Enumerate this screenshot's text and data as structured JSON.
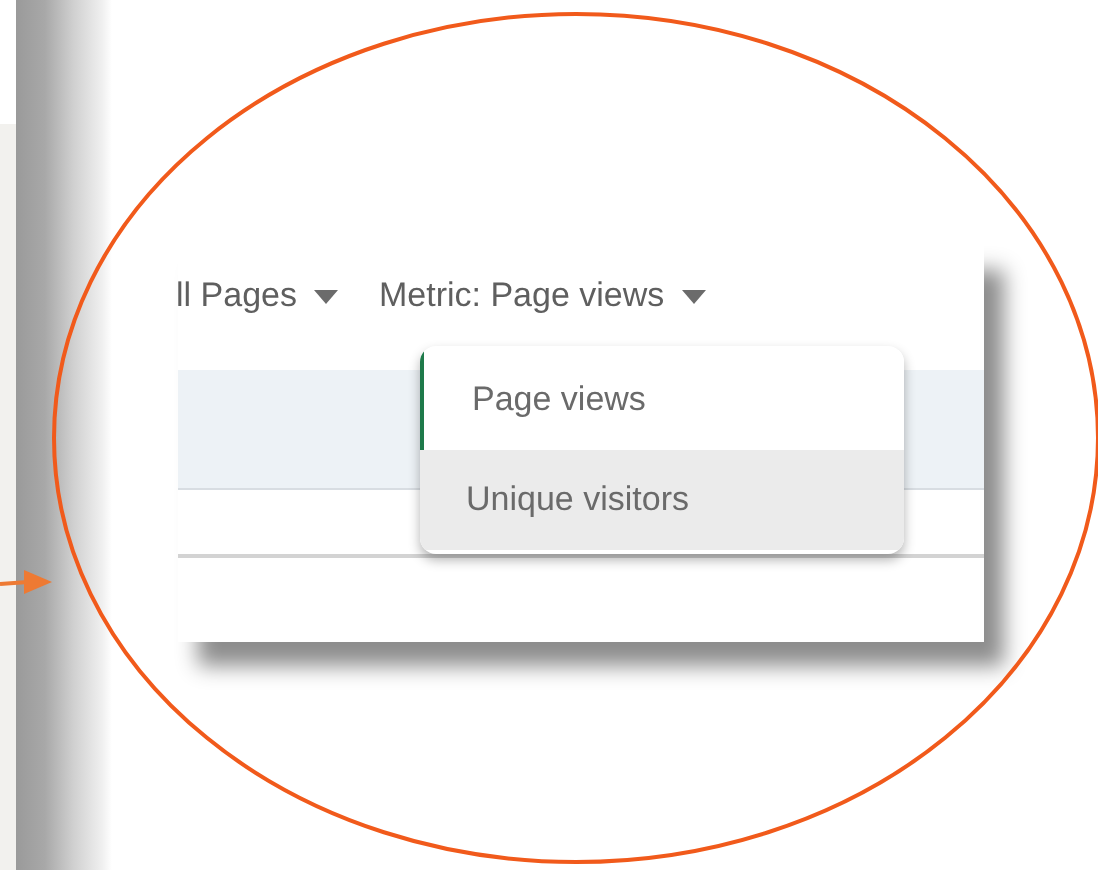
{
  "filters": [
    {
      "label": "ll Pages"
    },
    {
      "label": "Metric: Page views"
    }
  ],
  "metric_menu": {
    "items": [
      {
        "label": "Page views",
        "selected": true,
        "highlighted": false
      },
      {
        "label": "Unique visitors",
        "selected": false,
        "highlighted": true
      }
    ]
  }
}
